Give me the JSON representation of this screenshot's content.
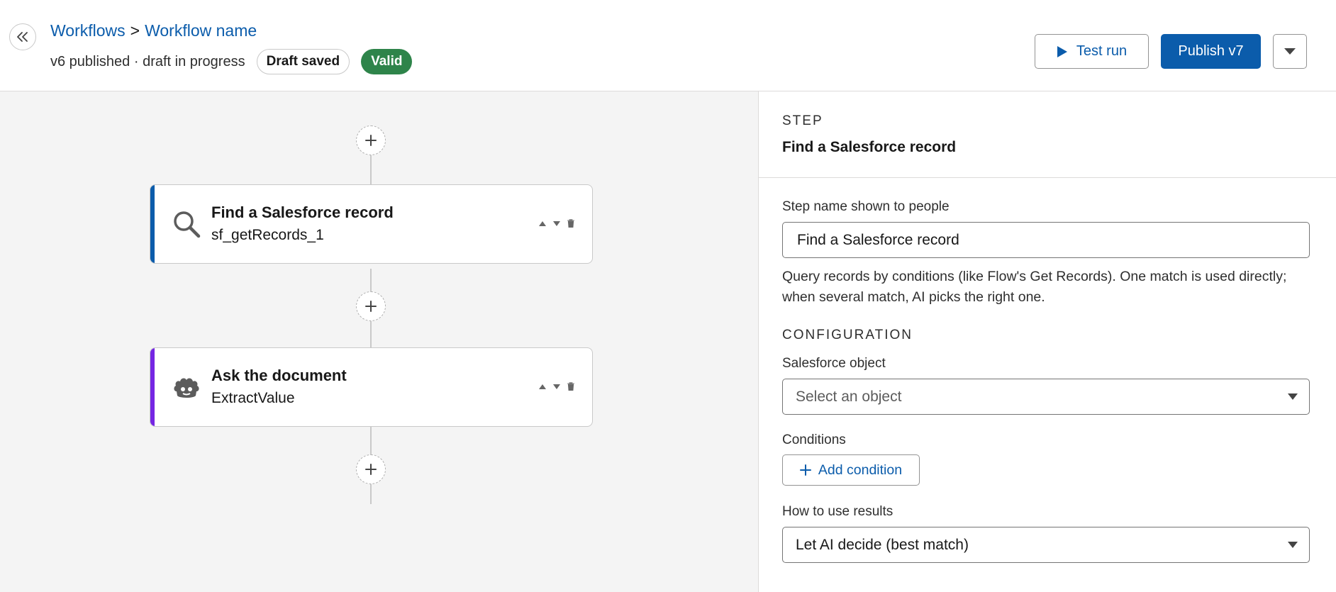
{
  "header": {
    "breadcrumb": {
      "root": "Workflows",
      "separator": ">",
      "current": "Workflow name"
    },
    "status_text": "v6 published · draft in progress",
    "badges": {
      "draft": "Draft saved",
      "valid": "Valid"
    },
    "actions": {
      "test_run": "Test run",
      "publish": "Publish v7"
    }
  },
  "canvas": {
    "steps": [
      {
        "title": "Find a Salesforce record",
        "subtitle": "sf_getRecords_1",
        "icon": "search-icon",
        "accent_color": "#0b5cab"
      },
      {
        "title": "Ask the document",
        "subtitle": "ExtractValue",
        "icon": "agent-icon",
        "accent_color": "#7526e3"
      }
    ]
  },
  "panel": {
    "eyebrow": "STEP",
    "title": "Find a Salesforce record",
    "step_name_label": "Step name shown to people",
    "step_name_value": "Find a Salesforce record",
    "help_text": "Query records by conditions (like Flow's Get Records). One match is used directly; when several match, AI picks the right one.",
    "config_heading": "CONFIGURATION",
    "object_label": "Salesforce object",
    "object_placeholder": "Select an object",
    "conditions_label": "Conditions",
    "add_condition": "Add condition",
    "results_label": "How to use results",
    "results_value": "Let AI decide (best match)"
  },
  "colors": {
    "brand": "#0b5cab",
    "valid": "#2e844a",
    "agent_accent": "#7526e3",
    "canvas_bg": "#f4f4f4"
  }
}
